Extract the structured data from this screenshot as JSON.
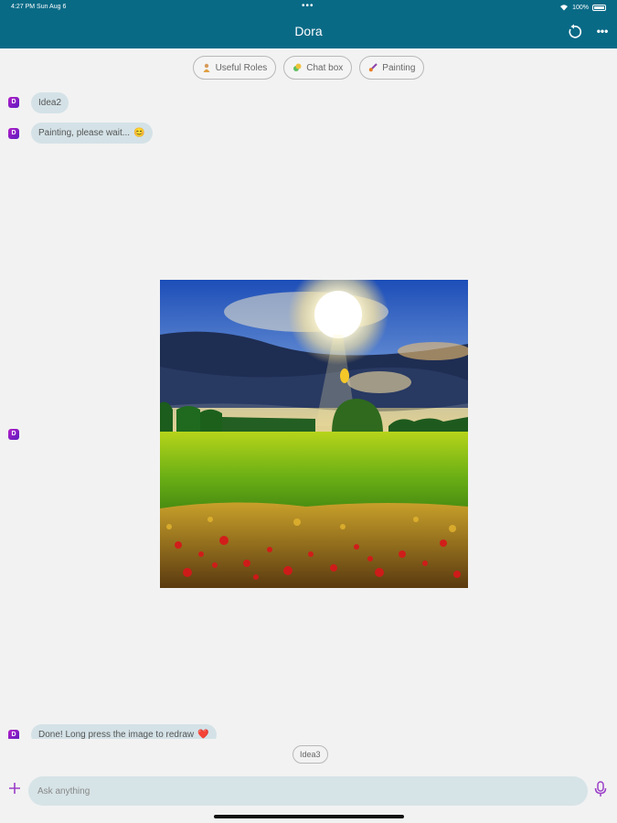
{
  "status": {
    "time": "4:27 PM",
    "date": "Sun Aug 6",
    "battery": "100%"
  },
  "header": {
    "title": "Dora",
    "refresh_icon": "refresh-icon",
    "more_icon": "more-icon"
  },
  "chips": [
    {
      "label": "Useful Roles",
      "icon": "person-icon"
    },
    {
      "label": "Chat box",
      "icon": "chat-icon"
    },
    {
      "label": "Painting",
      "icon": "brush-icon"
    }
  ],
  "messages": [
    {
      "avatar": "D",
      "text": "Idea2"
    },
    {
      "avatar": "D",
      "text": "Painting, please wait...",
      "emoji": "😊"
    },
    {
      "avatar": "D",
      "image": "generated-landscape-painting"
    },
    {
      "avatar": "D",
      "text": "Done! Long press the image to redraw",
      "emoji": "❤️"
    }
  ],
  "suggestion": "Idea3",
  "input": {
    "placeholder": "Ask anything",
    "value": ""
  },
  "colors": {
    "header": "#096a86",
    "bubble": "#d4e2e7",
    "accent": "#9b3fc8"
  }
}
